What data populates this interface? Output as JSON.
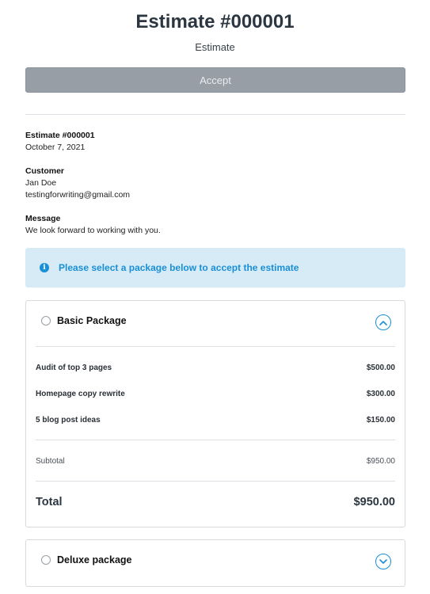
{
  "header": {
    "title": "Estimate #000001",
    "subtitle": "Estimate",
    "accept_label": "Accept"
  },
  "details": {
    "estimate_label": "Estimate #000001",
    "date": "October 7, 2021",
    "customer_label": "Customer",
    "customer_name": "Jan Doe",
    "customer_email": "testingforwriting@gmail.com",
    "message_label": "Message",
    "message_text": "We look forward to working with you."
  },
  "alert": {
    "icon": "info-icon",
    "icon_glyph": "i",
    "text": "Please select a package below to accept the estimate",
    "color": "#1a8fd6",
    "background": "#d6ebf6"
  },
  "packages": [
    {
      "name": "Basic Package",
      "expanded": true,
      "selected": false,
      "items": [
        {
          "label": "Audit of top 3 pages",
          "amount": "$500.00"
        },
        {
          "label": "Homepage copy rewrite",
          "amount": "$300.00"
        },
        {
          "label": "5 blog post ideas",
          "amount": "$150.00"
        }
      ],
      "subtotal_label": "Subtotal",
      "subtotal": "$950.00",
      "total_label": "Total",
      "total": "$950.00"
    },
    {
      "name": "Deluxe package",
      "expanded": false,
      "selected": false
    }
  ]
}
